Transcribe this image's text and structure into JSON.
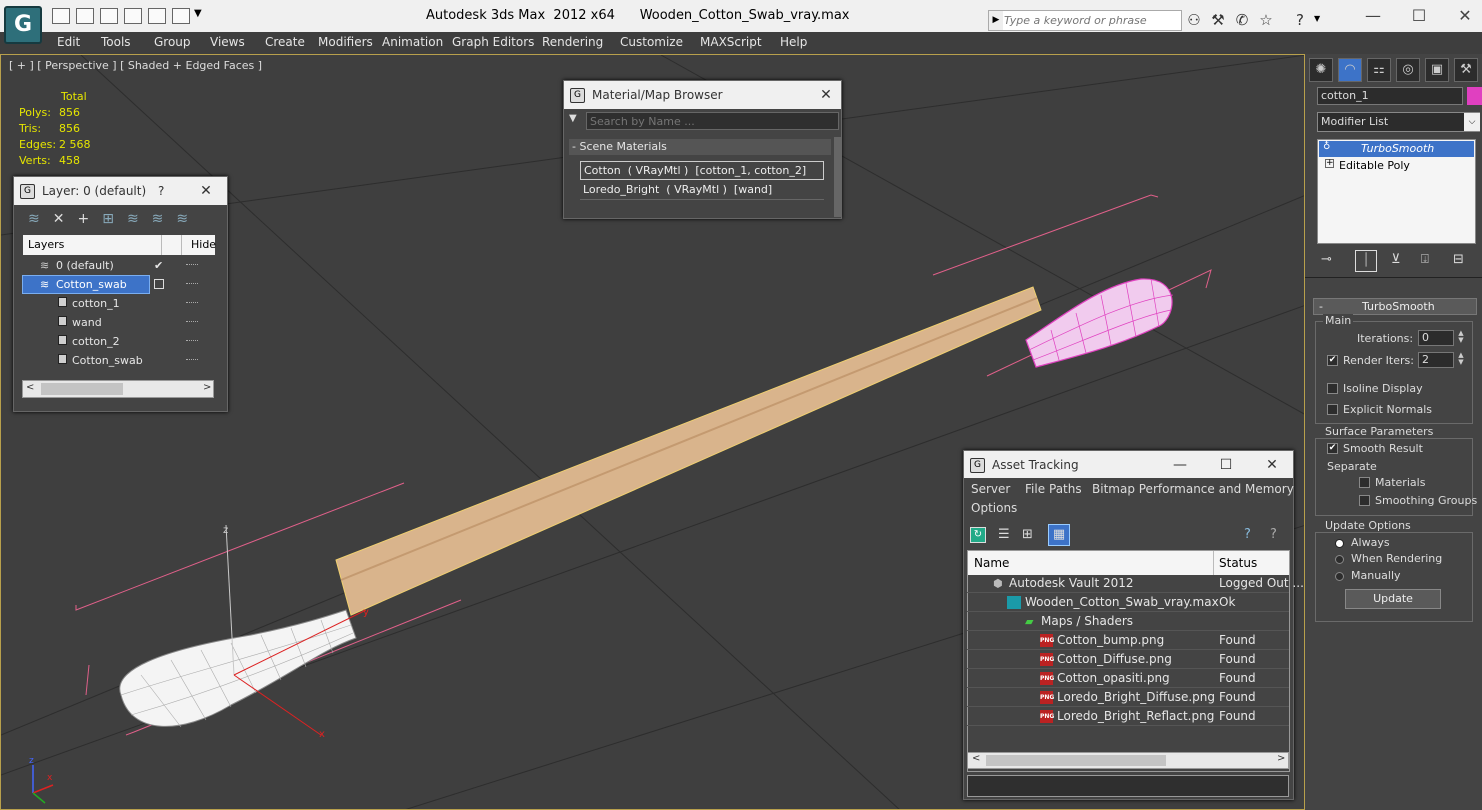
{
  "titlebar": {
    "logo": "3ds-max-logo",
    "app_title": "Autodesk 3ds Max  2012 x64",
    "file_name": "Wooden_Cotton_Swab_vray.max",
    "search_placeholder": "Type a keyword or phrase"
  },
  "menu": [
    "Edit",
    "Tools",
    "Group",
    "Views",
    "Create",
    "Modifiers",
    "Animation",
    "Graph Editors",
    "Rendering",
    "Customize",
    "MAXScript",
    "Help"
  ],
  "viewport": {
    "label": "[ + ] [ Perspective ] [ Shaded + Edged Faces ]",
    "stats": {
      "header": "Total",
      "rows": [
        {
          "label": "Polys:",
          "value": "856"
        },
        {
          "label": "Tris:",
          "value": "856"
        },
        {
          "label": "Edges:",
          "value": "2 568"
        },
        {
          "label": "Verts:",
          "value": "458"
        }
      ]
    },
    "gizmo_axes": {
      "x": "x",
      "y": "y",
      "z": "z"
    },
    "axis_icon_labels": {
      "z": "z",
      "x": "x"
    },
    "colors": {
      "wood": "#d9b48c",
      "cotton_selected": "#e070e0",
      "cotton_white": "#f4f4f4",
      "bounds": "#e0608a"
    }
  },
  "layer_panel": {
    "title": "Layer: 0 (default)",
    "help": "?",
    "columns": {
      "layers": "Layers",
      "hide": "Hide"
    },
    "rows": [
      {
        "name": "0 (default)",
        "level": 0,
        "checked": true
      },
      {
        "name": "Cotton_swab",
        "level": 0,
        "selected": true
      },
      {
        "name": "cotton_1",
        "level": 1
      },
      {
        "name": "wand",
        "level": 1
      },
      {
        "name": "cotton_2",
        "level": 1
      },
      {
        "name": "Cotton_swab",
        "level": 1
      }
    ]
  },
  "material_browser": {
    "title": "Material/Map Browser",
    "search_placeholder": "Search by Name ...",
    "section": "- Scene Materials",
    "items": [
      "Cotton  ( VRayMtl )  [cotton_1, cotton_2]",
      "Loredo_Bright  ( VRayMtl )  [wand]"
    ]
  },
  "asset_tracking": {
    "title": "Asset Tracking",
    "menu": [
      "Server",
      "File",
      "Paths",
      "Bitmap Performance and Memory",
      "Options"
    ],
    "columns": {
      "name": "Name",
      "status": "Status"
    },
    "rows": [
      {
        "name": "Autodesk Vault 2012",
        "status": "Logged Out ...",
        "indent": 1,
        "icon": "vault-icon"
      },
      {
        "name": "Wooden_Cotton_Swab_vray.max",
        "status": "Ok",
        "indent": 2,
        "icon": "max-file-icon"
      },
      {
        "name": "Maps / Shaders",
        "status": "",
        "indent": 3,
        "icon": "maps-icon"
      },
      {
        "name": "Cotton_bump.png",
        "status": "Found",
        "indent": 4,
        "icon": "png-icon"
      },
      {
        "name": "Cotton_Diffuse.png",
        "status": "Found",
        "indent": 4,
        "icon": "png-icon"
      },
      {
        "name": "Cotton_opasiti.png",
        "status": "Found",
        "indent": 4,
        "icon": "png-icon"
      },
      {
        "name": "Loredo_Bright_Diffuse.png",
        "status": "Found",
        "indent": 4,
        "icon": "png-icon"
      },
      {
        "name": "Loredo_Bright_Reflact.png",
        "status": "Found",
        "indent": 4,
        "icon": "png-icon"
      }
    ],
    "png_label": "PNG"
  },
  "command_panel": {
    "object_name": "cotton_1",
    "object_color": "#e040c0",
    "modifier_list": "Modifier List",
    "stack": [
      {
        "name": "TurboSmooth",
        "selected": true
      },
      {
        "name": "Editable Poly",
        "selected": false
      }
    ],
    "rollout_title": "TurboSmooth",
    "main": {
      "label": "Main",
      "iterations_label": "Iterations:",
      "iterations": "0",
      "render_iters_label": "Render Iters:",
      "render_iters": "2",
      "render_iters_checked": true,
      "isoline": "Isoline Display",
      "explicit": "Explicit Normals"
    },
    "surface": {
      "label": "Surface Parameters",
      "smooth_result": "Smooth Result",
      "separate": "Separate",
      "materials": "Materials",
      "smoothing_groups": "Smoothing Groups"
    },
    "update": {
      "label": "Update Options",
      "always": "Always",
      "when_rendering": "When Rendering",
      "manually": "Manually",
      "button": "Update"
    }
  }
}
